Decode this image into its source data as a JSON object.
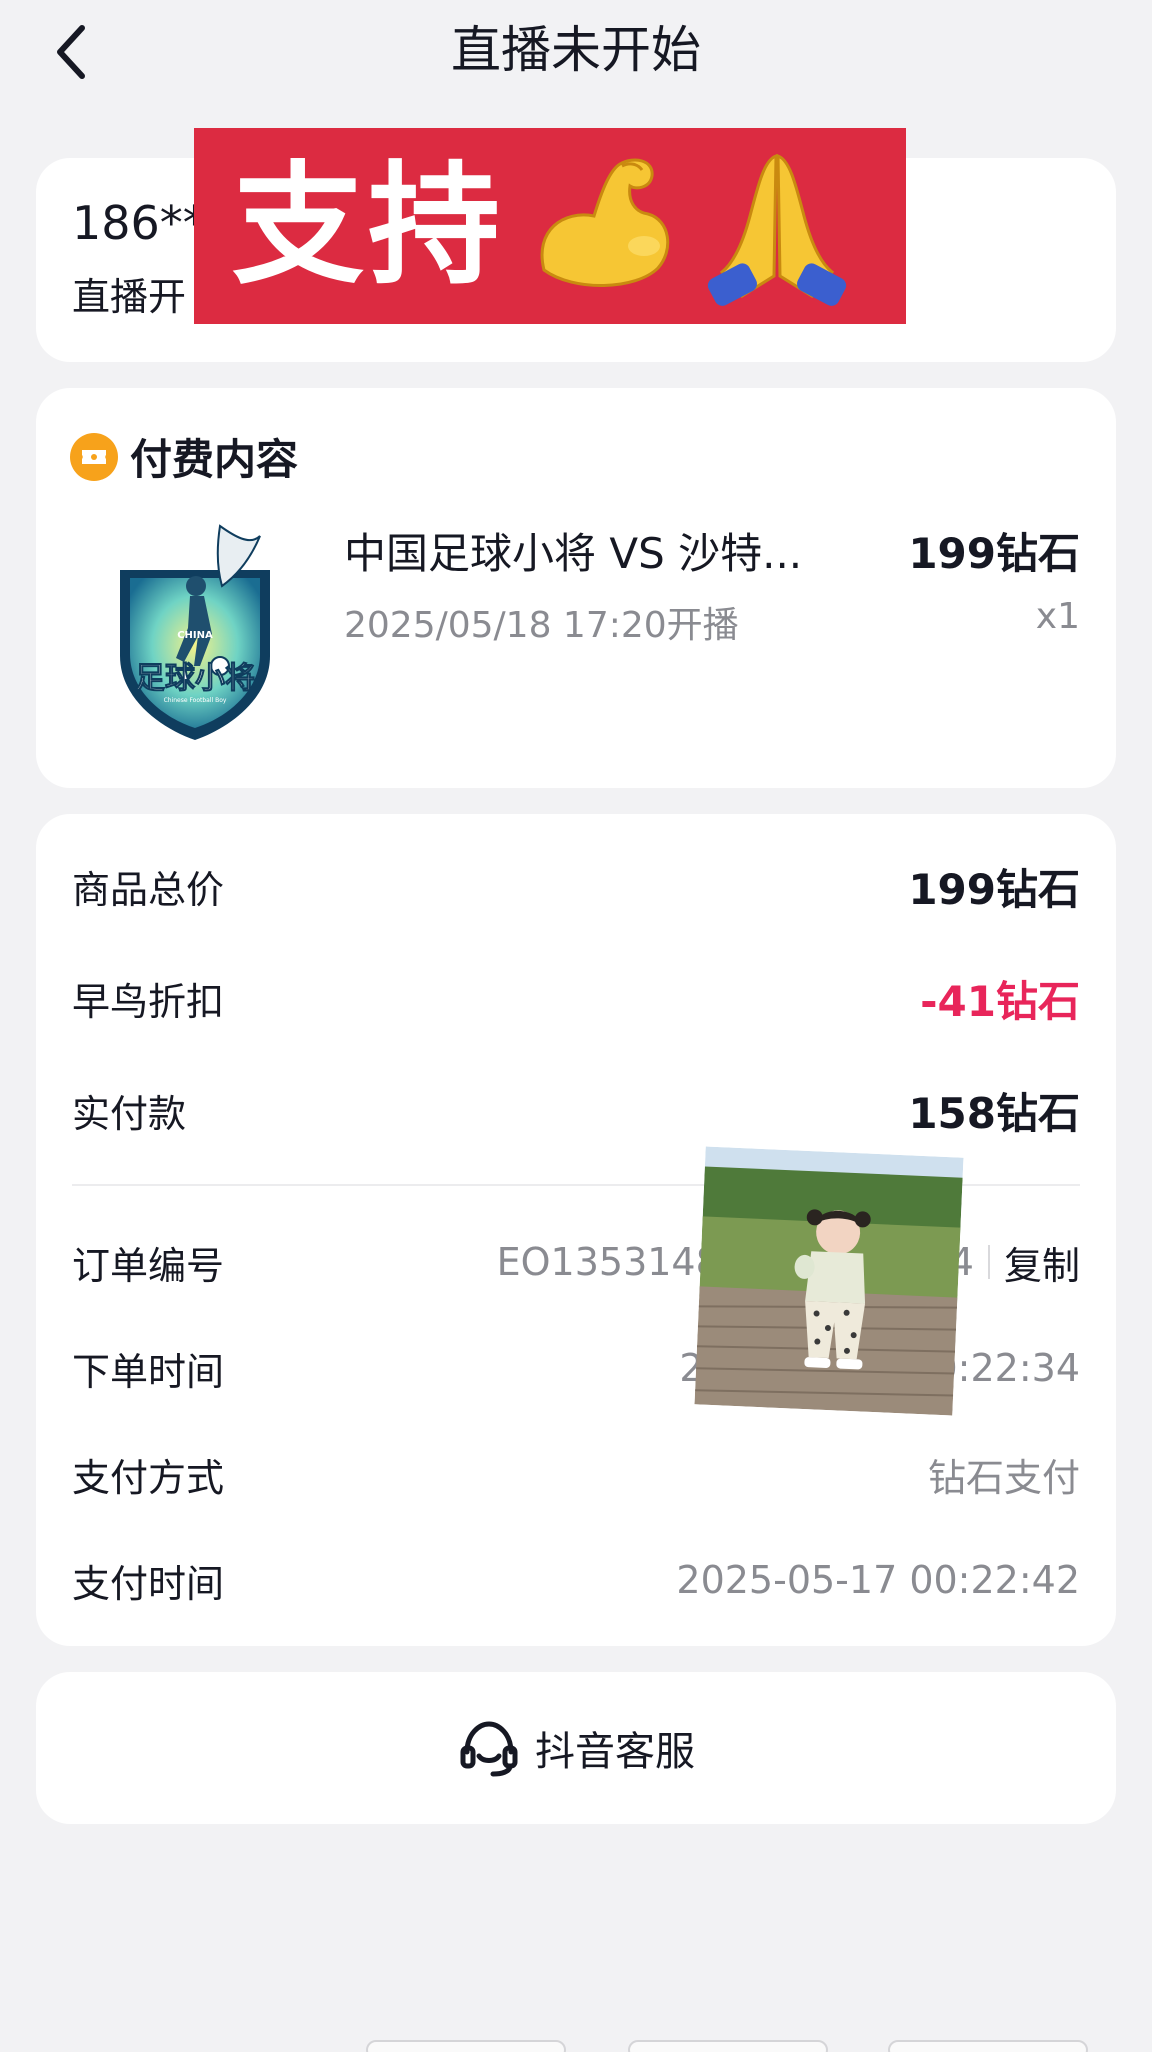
{
  "header": {
    "title": "直播未开始",
    "back_icon": "chevron-left-icon"
  },
  "status": {
    "user": "186**",
    "sub": "直播开"
  },
  "stickers": {
    "support_text": "支持",
    "support_emojis": [
      "flexed-biceps",
      "folded-hands"
    ],
    "baby": "photo of a toddler walking on a boardwalk"
  },
  "paid": {
    "title": "付费内容",
    "icon": "ticket-icon",
    "product": {
      "name": "中国足球小将 VS 沙特...",
      "price": "199钻石",
      "time": "2025/05/18 17:20开播",
      "qty": "x1"
    },
    "logo": {
      "top": "CHINA",
      "main": "足球小将",
      "sub": "Chinese Football Boy"
    }
  },
  "order": {
    "total_label": "商品总价",
    "total_value": "199钻石",
    "discount_label": "早鸟折扣",
    "discount_value": "-41钻石",
    "paid_label": "实付款",
    "paid_value": "158钻石",
    "number_label": "订单编号",
    "number_value": "EO1353148",
    "number_tail": "4",
    "copy_label": "复制",
    "order_time_label": "下单时间",
    "order_time_value_left": "2",
    "order_time_value": "0:22:34",
    "pay_method_label": "支付方式",
    "pay_method_value": "钻石支付",
    "pay_time_label": "支付时间",
    "pay_time_value": "2025-05-17 00:22:42"
  },
  "service": {
    "label": "抖音客服",
    "icon": "headset-icon"
  },
  "colors": {
    "accent_red": "#e8255a",
    "sticker_red": "#dc2b41",
    "badge_orange": "#f7a21b"
  }
}
